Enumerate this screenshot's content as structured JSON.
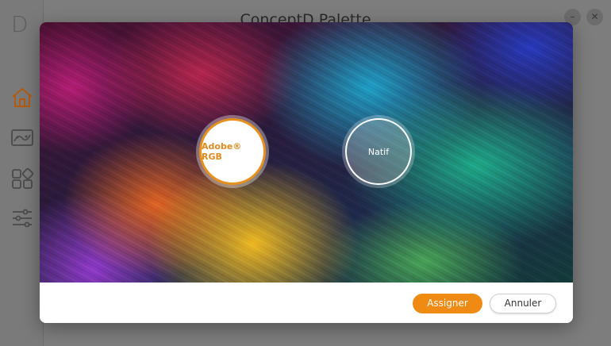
{
  "app": {
    "logo_text": "D",
    "title": "ConceptD Palette",
    "minimize_glyph": "–",
    "close_glyph": "✕"
  },
  "sidebar": {
    "items": [
      {
        "name": "home",
        "icon": "home-icon",
        "active": true
      },
      {
        "name": "display",
        "icon": "display-curve-icon"
      },
      {
        "name": "apps",
        "icon": "apps-grid-icon"
      },
      {
        "name": "settings",
        "icon": "sliders-icon"
      }
    ]
  },
  "dialog": {
    "options": [
      {
        "label": "Adobe® RGB",
        "selected": true
      },
      {
        "label": "Natif",
        "selected": false
      }
    ],
    "assign_label": "Assigner",
    "cancel_label": "Annuler"
  },
  "colors": {
    "accent": "#ef8a12",
    "overlay": "#7d7d7d"
  }
}
